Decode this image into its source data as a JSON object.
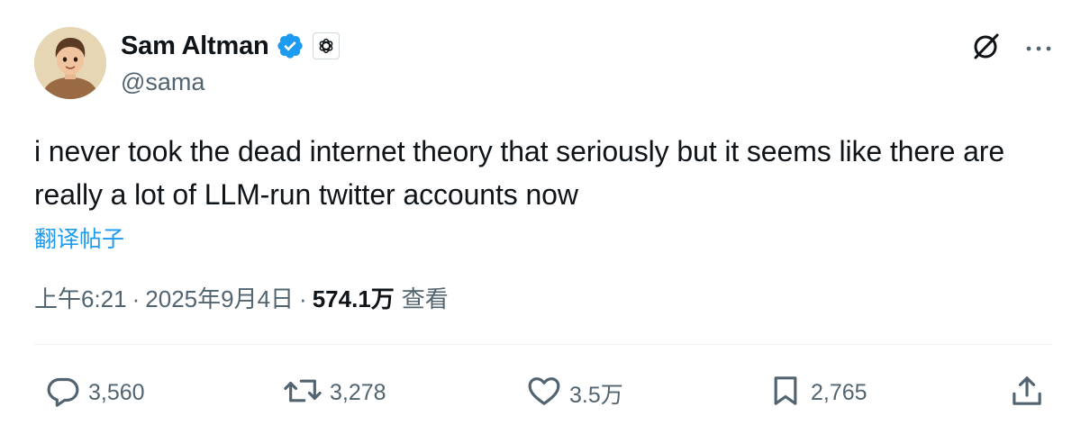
{
  "author": {
    "display_name": "Sam Altman",
    "handle": "@sama",
    "verified_color": "#1d9bf0"
  },
  "tweet": {
    "text": "i never took the dead internet theory that seriously but it seems like there are really a lot of LLM-run twitter accounts now",
    "translate_label": "翻译帖子"
  },
  "meta": {
    "time": "上午6:21",
    "separator": "·",
    "date": "2025年9月4日",
    "views_count": "574.1万",
    "views_label": "查看"
  },
  "actions": {
    "replies": "3,560",
    "reposts": "3,278",
    "likes": "3.5万",
    "bookmarks": "2,765"
  },
  "icons": {
    "verified": "verified-badge-icon",
    "affiliate": "openai-logo-icon",
    "grok": "grok-icon",
    "more": "more-options-icon",
    "reply": "reply-icon",
    "repost": "repost-icon",
    "like": "heart-icon",
    "bookmark": "bookmark-icon",
    "share": "share-icon"
  },
  "colors": {
    "text": "#0f1419",
    "secondary": "#536471",
    "link": "#1d9bf0"
  }
}
